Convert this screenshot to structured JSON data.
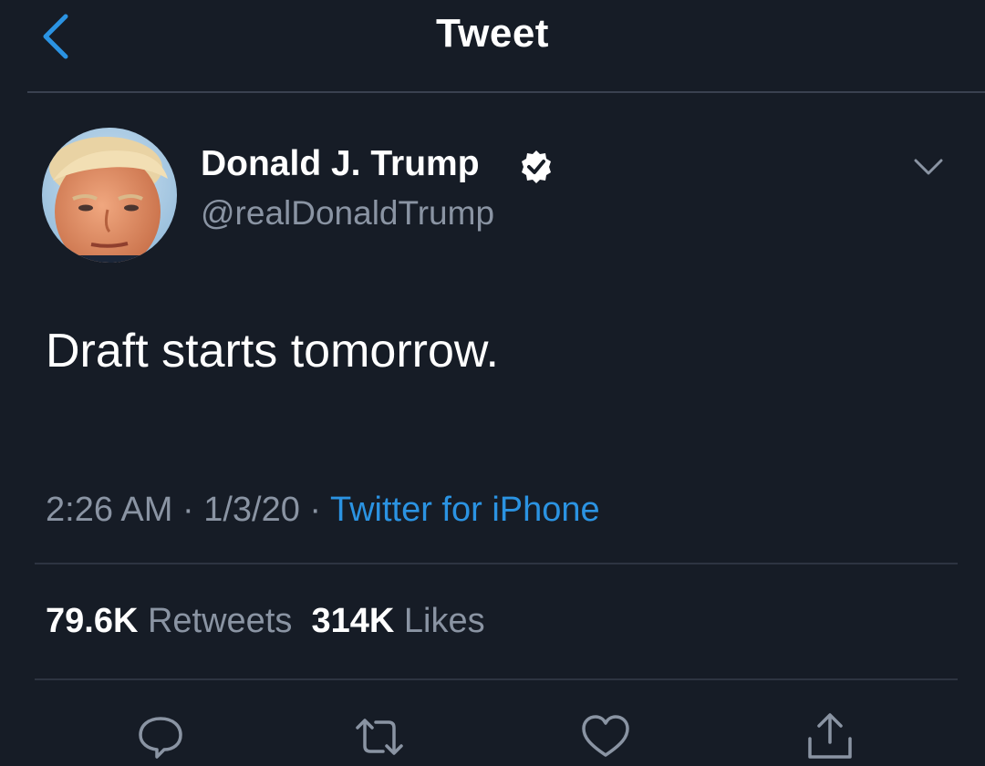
{
  "header": {
    "title": "Tweet",
    "back_icon": "chevron-left-icon"
  },
  "tweet": {
    "author": {
      "name": "Donald J. Trump",
      "handle": "@realDonaldTrump",
      "verified": true
    },
    "text": "Draft starts tomorrow.",
    "time": "2:26 AM",
    "separator": "·",
    "date": "1/3/20",
    "source": "Twitter for iPhone",
    "retweets": {
      "count": "79.6K",
      "label": "Retweets"
    },
    "likes": {
      "count": "314K",
      "label": "Likes"
    }
  },
  "actions": [
    "reply-icon",
    "retweet-icon",
    "like-icon",
    "share-icon"
  ],
  "colors": {
    "background": "#161c26",
    "accent": "#2b93e2",
    "secondary_text": "#8a94a3",
    "divider": "#2d3441"
  }
}
